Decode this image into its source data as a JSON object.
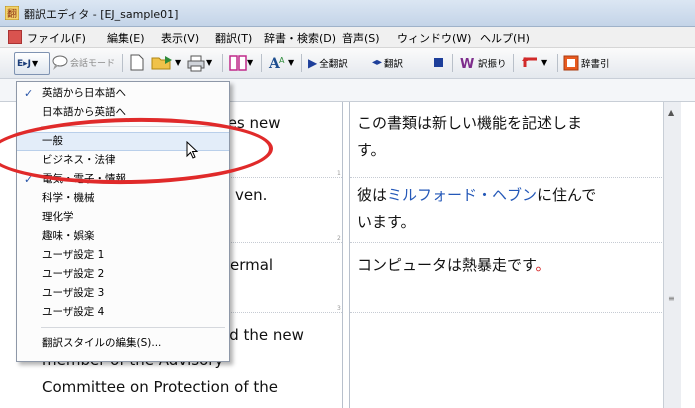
{
  "window": {
    "title": "翻訳エディタ - [EJ_sample01]"
  },
  "menu": {
    "items": [
      "ファイル(F)",
      "編集(E)",
      "表示(V)",
      "翻訳(T)",
      "辞書・検索(D)",
      "音声(S)",
      "ウィンドウ(W)",
      "ヘルプ(H)"
    ]
  },
  "toolbar": {
    "direction_btn": "E▸J",
    "conversation_mode": "会話モード",
    "translate_all": "全翻訳",
    "translate": "翻訳",
    "furigana": "訳振り",
    "dictionary": "辞書引"
  },
  "dropdown": {
    "items": [
      {
        "label": "英語から日本語へ",
        "checked": true
      },
      {
        "label": "日本語から英語へ",
        "checked": false
      },
      {
        "label": "一般",
        "checked": false,
        "highlighted": true
      },
      {
        "label": "ビジネス・法律",
        "checked": false
      },
      {
        "label": "電気・電子・情報",
        "checked": true
      },
      {
        "label": "科学・機械",
        "checked": false
      },
      {
        "label": "理化学",
        "checked": false
      },
      {
        "label": "趣味・娯楽",
        "checked": false
      },
      {
        "label": "ユーザ設定 1",
        "checked": false
      },
      {
        "label": "ユーザ設定 2",
        "checked": false
      },
      {
        "label": "ユーザ設定 3",
        "checked": false
      },
      {
        "label": "ユーザ設定 4",
        "checked": false
      },
      {
        "label": "翻訳スタイルの編集(S)...",
        "checked": false
      }
    ]
  },
  "source": {
    "seg1": "ibes new",
    "seg2": "ven.",
    "seg3": "ermal",
    "seg4_line1": "ed the new",
    "seg4_line2": "member of the Advisory",
    "seg4_line3": "Committee on Protection of the"
  },
  "target": {
    "seg1_line1": "この書類は新しい機能を記述しま",
    "seg1_line2": "す。",
    "seg2_pre": "彼は",
    "seg2_name": "ミルフォード・ヘブン",
    "seg2_post": "に住んで",
    "seg2_line2": "います。",
    "seg3": "コンピュータは熱暴走です",
    "seg3_mark": "。"
  },
  "line_numbers": [
    "1",
    "2",
    "3"
  ],
  "colors": {
    "highlight_circle": "#e02a2a",
    "link_blue": "#2458b8"
  }
}
